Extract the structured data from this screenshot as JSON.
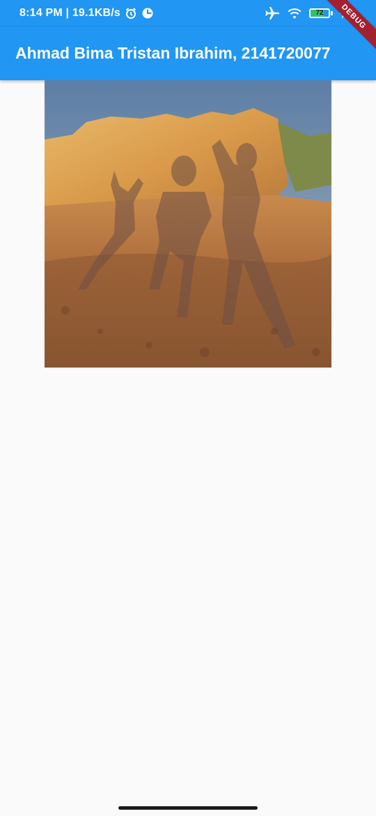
{
  "status_bar": {
    "time": "8:14 PM | 19.1KB/s",
    "battery_level": "72",
    "icons": [
      "alarm-icon",
      "data-saver-icon",
      "airplane-mode-icon",
      "wifi-icon",
      "battery-icon",
      "charging-icon"
    ]
  },
  "app_bar": {
    "title": "Ahmad Bima Tristan Ibrahim, 2141720077",
    "color": "#2196f3"
  },
  "debug_banner": "DEBUG",
  "image": {
    "description_icon": "photo-image",
    "battery_fill_color": "#35c16a"
  },
  "colors": {
    "background": "#fafafa",
    "debug_banner": "#a3202f"
  }
}
